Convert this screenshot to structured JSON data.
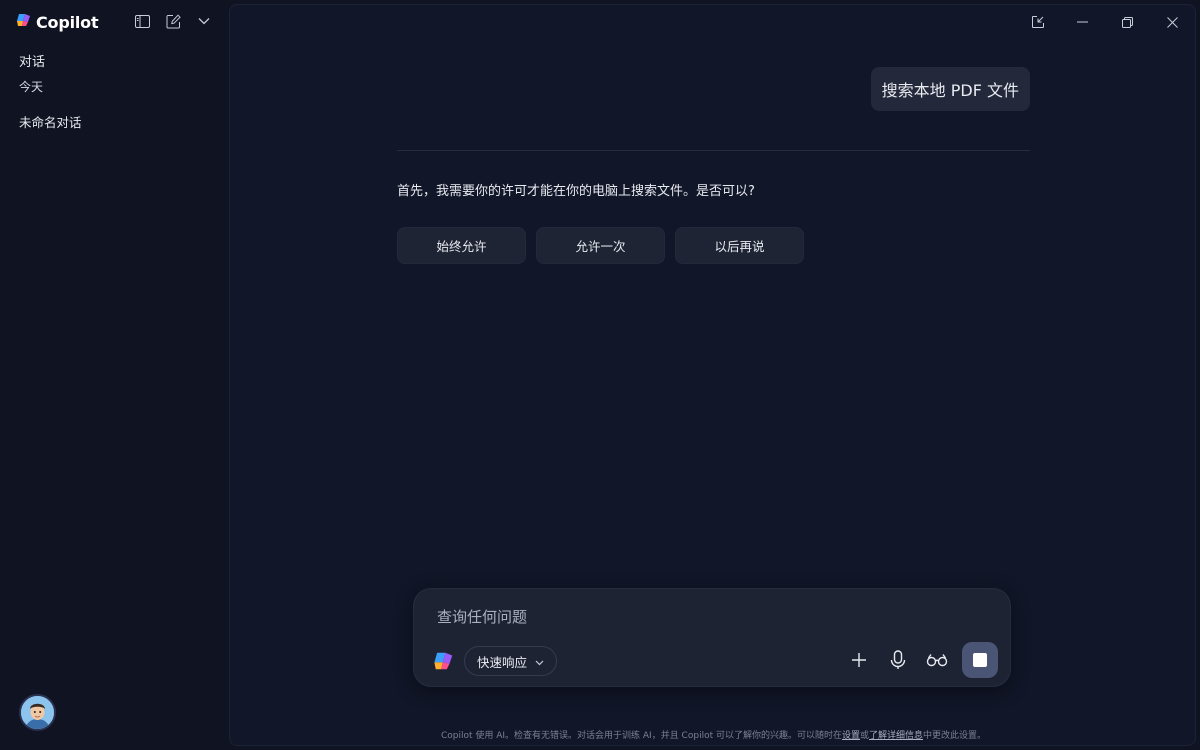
{
  "app": {
    "name": "Copilot"
  },
  "sidebar": {
    "heading": "对话",
    "group_label": "今天",
    "items": [
      {
        "label": "未命名对话"
      }
    ]
  },
  "conversation": {
    "user_message": "搜索本地 PDF 文件",
    "assistant_message": "首先，我需要你的许可才能在你的电脑上搜索文件。是否可以?",
    "choices": [
      "始终允许",
      "允许一次",
      "以后再说"
    ]
  },
  "composer": {
    "placeholder": "查询任何问题",
    "mode_label": "快速响应"
  },
  "footer": {
    "text_before": "Copilot 使用 AI。检查有无错误。对话会用于训练 AI，并且 Copilot 可以了解你的兴趣。可以随时在",
    "link_settings": "设置",
    "text_middle": "或",
    "link_details": "了解详细信息",
    "text_after": "中更改此设置。"
  },
  "colors": {
    "background": "#0f1322",
    "panel": "#111628",
    "bubble": "#23283a",
    "button": "#1f2435",
    "composer": "#1e2334",
    "stop_button": "#4a5576"
  },
  "icons": {
    "brand": "copilot-logo-icon",
    "sidebar_toggle": "sidebar-toggle-icon",
    "new_chat": "new-chat-icon",
    "expand": "chevron-down-icon",
    "popout": "popout-icon",
    "minimize": "minimize-icon",
    "restore": "restore-icon",
    "close": "close-icon",
    "add": "plus-icon",
    "mic": "microphone-icon",
    "vision": "glasses-icon",
    "stop": "stop-icon"
  }
}
